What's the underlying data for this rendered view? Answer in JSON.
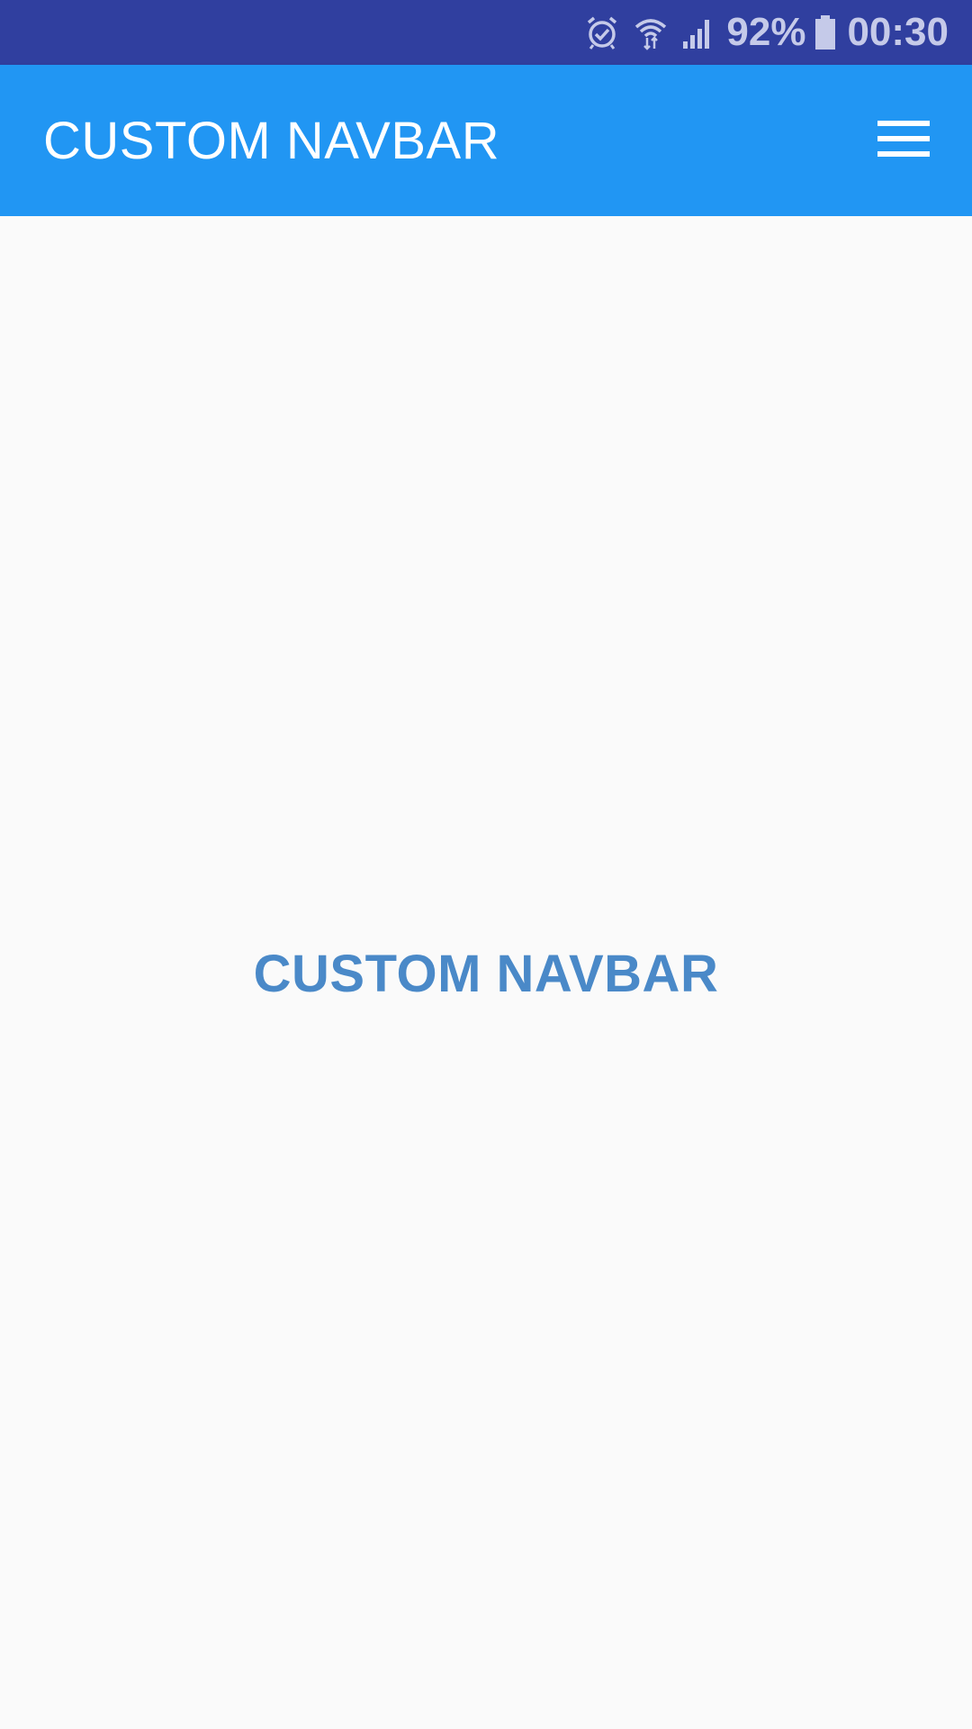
{
  "status_bar": {
    "icons": [
      "alarm-icon",
      "wifi-icon",
      "signal-icon",
      "battery-icon"
    ],
    "battery_percent": "92%",
    "battery_level": 0.92,
    "time": "00:30",
    "background": "#303f9f",
    "foreground": "#c5cae9"
  },
  "app_bar": {
    "title": "CUSTOM NAVBAR",
    "menu_icon": "hamburger-menu-icon",
    "background": "#2196f3"
  },
  "content": {
    "center_label": "CUSTOM NAVBAR",
    "label_color": "#4a89c8",
    "background": "#fafafa"
  }
}
